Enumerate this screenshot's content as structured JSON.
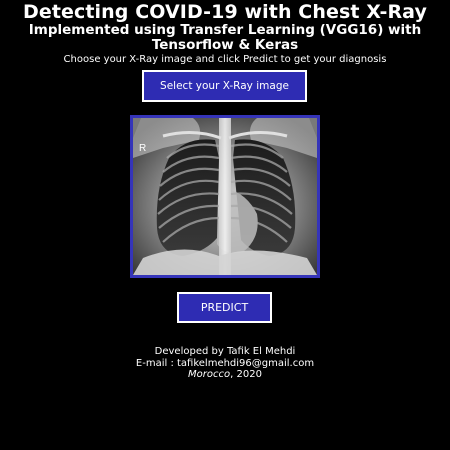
{
  "header": {
    "title": "Detecting COVID-19 with Chest X-Ray",
    "subtitle": "Implemented using Transfer Learning (VGG16) with Tensorflow & Keras",
    "instructions": "Choose your X-Ray image and click Predict to get your diagnosis"
  },
  "upload": {
    "select_label": "Select your X-Ray image"
  },
  "preview": {
    "marker": "R"
  },
  "actions": {
    "predict_label": "PREDICT"
  },
  "footer": {
    "developer": "Developed by Tafik El Mehdi",
    "email": "E-mail : tafikelmehdi96@gmail.com",
    "place": "Morocco",
    "year_suffix": ", 2020"
  },
  "colors": {
    "background": "#000000",
    "button": "#2e2cb3",
    "frame_border": "#3534b9",
    "text": "#ffffff"
  }
}
